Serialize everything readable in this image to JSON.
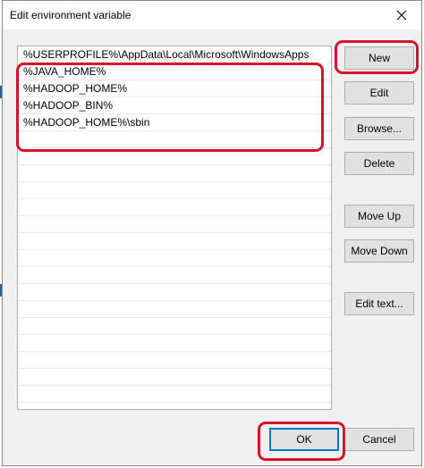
{
  "window": {
    "title": "Edit environment variable"
  },
  "list": {
    "items": [
      "%USERPROFILE%\\AppData\\Local\\Microsoft\\WindowsApps",
      "%JAVA_HOME%",
      "%HADOOP_HOME%",
      "%HADOOP_BIN%",
      "%HADOOP_HOME%\\sbin"
    ]
  },
  "buttons": {
    "new": "New",
    "edit": "Edit",
    "browse": "Browse...",
    "delete": "Delete",
    "move_up": "Move Up",
    "move_down": "Move Down",
    "edit_text": "Edit text...",
    "ok": "OK",
    "cancel": "Cancel"
  },
  "colors": {
    "highlight": "#d9122c",
    "focus": "#0078d7"
  }
}
